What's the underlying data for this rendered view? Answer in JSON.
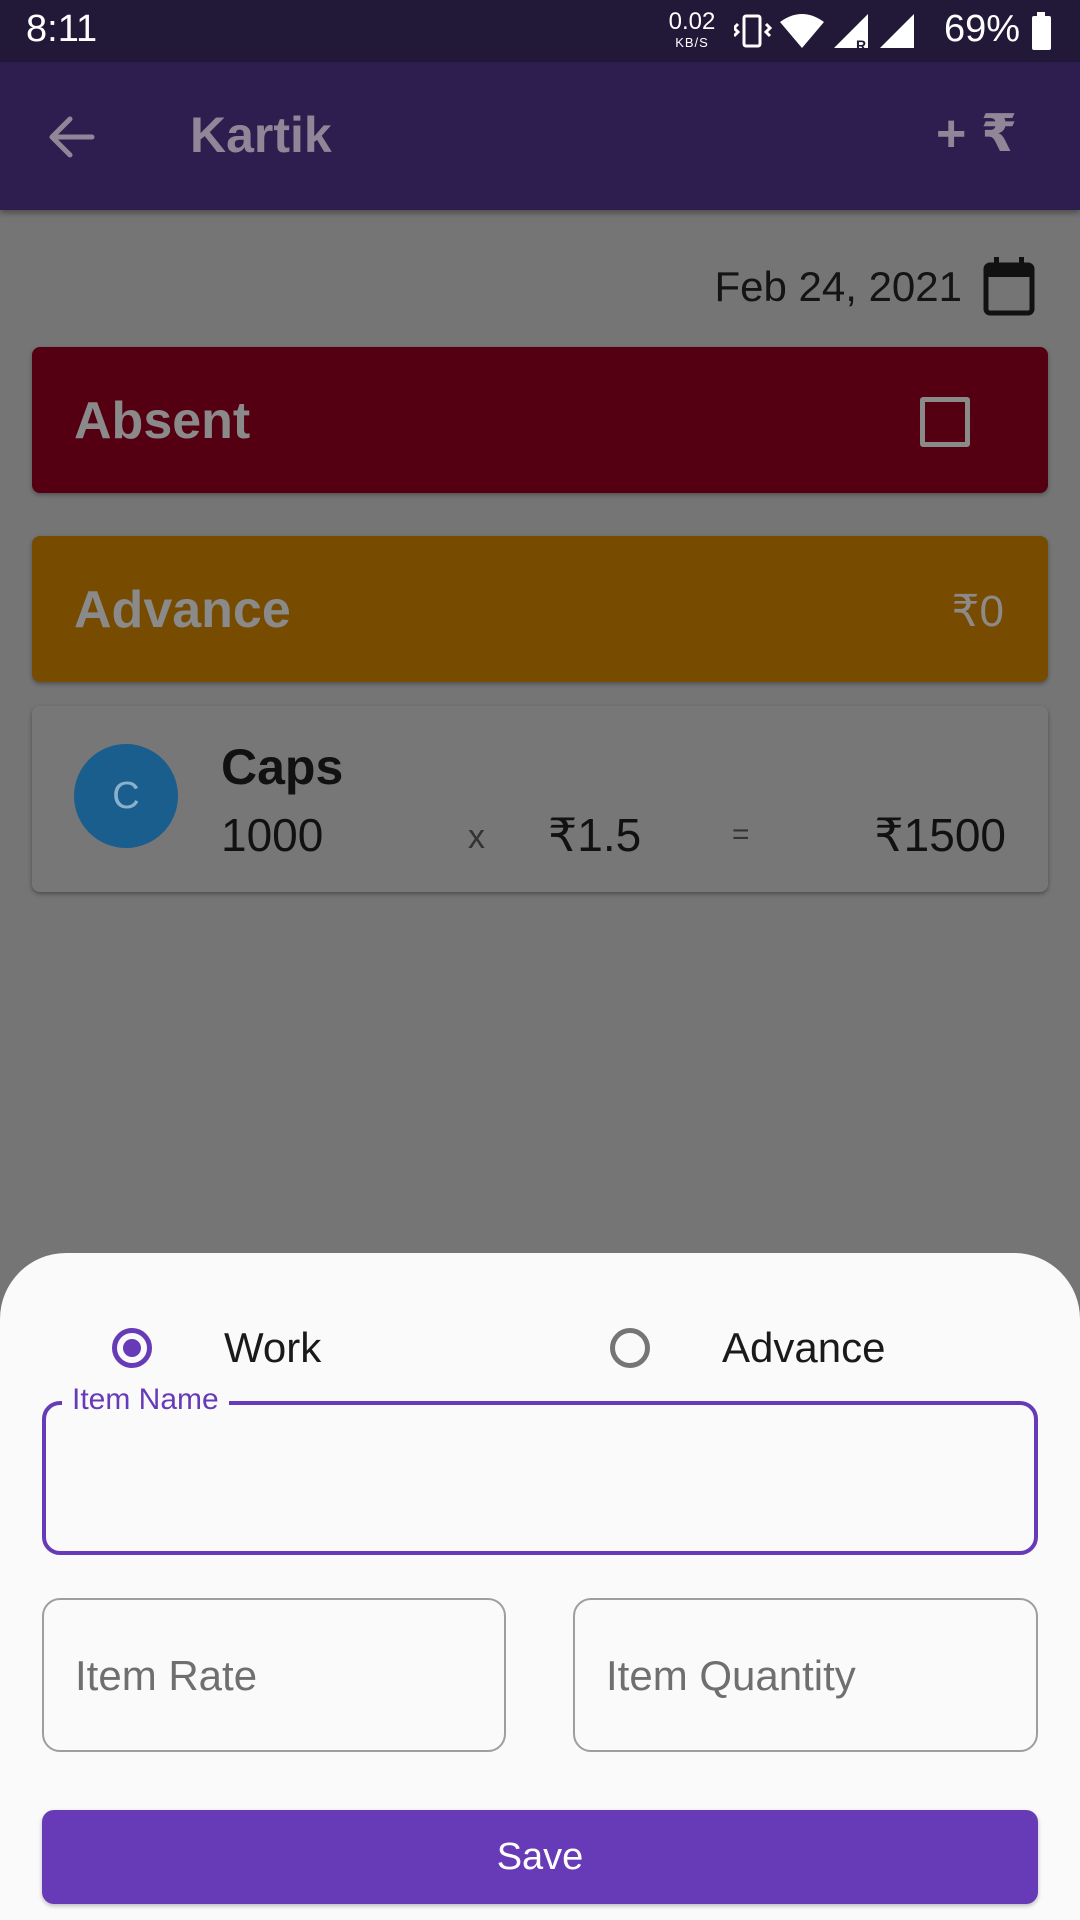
{
  "status_bar": {
    "time": "8:11",
    "net_speed_value": "0.02",
    "net_speed_unit": "KB/S",
    "battery_percent": "69%",
    "icons": [
      "vibrate-icon",
      "wifi-icon",
      "signal-roaming-icon",
      "signal-icon",
      "battery-icon"
    ]
  },
  "app_bar": {
    "title": "Kartik",
    "back_icon": "arrow-left-icon",
    "action_label": "+ ₹"
  },
  "date": {
    "value": "Feb 24, 2021",
    "icon": "calendar-icon"
  },
  "absent_card": {
    "label": "Absent",
    "checked": false,
    "color": "#550012"
  },
  "advance_card": {
    "label": "Advance",
    "amount": "₹0",
    "color": "#774b00"
  },
  "work_items": [
    {
      "avatar_letter": "C",
      "name": "Caps",
      "quantity": "1000",
      "times": "x",
      "rate": "₹1.5",
      "equals": "=",
      "total": "₹1500"
    }
  ],
  "bottom_sheet": {
    "radio_options": [
      {
        "label": "Work",
        "selected": true
      },
      {
        "label": "Advance",
        "selected": false
      }
    ],
    "item_name_label": "Item Name",
    "item_name_value": "",
    "item_rate_placeholder": "Item Rate",
    "item_quantity_placeholder": "Item Quantity",
    "save_label": "Save",
    "accent_color": "#673ab7"
  }
}
